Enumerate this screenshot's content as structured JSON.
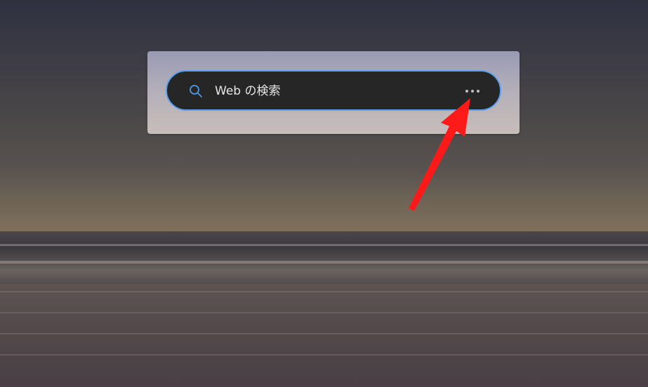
{
  "search": {
    "placeholder": "Web の検索",
    "icon": "search-icon",
    "more_icon": "more-options-icon"
  },
  "annotation": {
    "arrow_color": "#ff1a1a"
  },
  "colors": {
    "search_box_bg": "#262626",
    "search_box_border": "#5b9ff0"
  }
}
